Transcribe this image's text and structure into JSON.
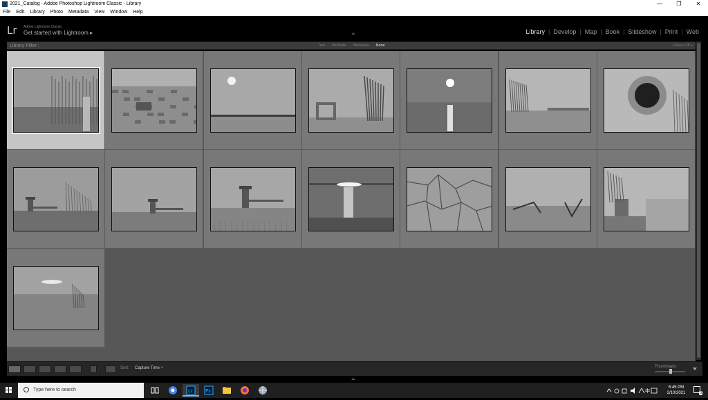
{
  "window": {
    "title": "2021_Catalog - Adobe Photoshop Lightroom Classic - Library",
    "controls": [
      "—",
      "❐",
      "✕"
    ]
  },
  "menu": [
    "File",
    "Edit",
    "Library",
    "Photo",
    "Metadata",
    "View",
    "Window",
    "Help"
  ],
  "identity": {
    "logo": "Lr",
    "product": "Adobe Lightroom Classic",
    "tagline": "Get started with Lightroom",
    "arrow": "▸"
  },
  "modules": [
    "Library",
    "Develop",
    "Map",
    "Book",
    "Slideshow",
    "Print",
    "Web"
  ],
  "active_module": "Library",
  "filter_bar": {
    "label": "Library Filter :",
    "options": [
      "Text",
      "Attribute",
      "Metadata",
      "None"
    ],
    "active_option": "None",
    "filters_off": "Filters Off ÷"
  },
  "grid": {
    "photos": [
      {
        "id": 1,
        "selected": true,
        "scene": "foggy-trees"
      },
      {
        "id": 2,
        "selected": false,
        "scene": "rocky-shore"
      },
      {
        "id": 3,
        "selected": false,
        "scene": "sun-horizon"
      },
      {
        "id": 4,
        "selected": false,
        "scene": "gate-trees"
      },
      {
        "id": 5,
        "selected": false,
        "scene": "sun-water"
      },
      {
        "id": 6,
        "selected": false,
        "scene": "shore-trees"
      },
      {
        "id": 7,
        "selected": false,
        "scene": "pipe-hole"
      },
      {
        "id": 8,
        "selected": false,
        "scene": "pavilion-fog"
      },
      {
        "id": 9,
        "selected": false,
        "scene": "pavilion-far"
      },
      {
        "id": 10,
        "selected": false,
        "scene": "pavilion-near"
      },
      {
        "id": 11,
        "selected": false,
        "scene": "sun-reflection"
      },
      {
        "id": 12,
        "selected": false,
        "scene": "cracked-mud"
      },
      {
        "id": 13,
        "selected": false,
        "scene": "driftwood"
      },
      {
        "id": 14,
        "selected": false,
        "scene": "ruins-shore"
      },
      {
        "id": 15,
        "selected": false,
        "scene": "reeds-sun"
      }
    ]
  },
  "toolbar": {
    "sort_label": "Sort:",
    "sort_value": "Capture Time ÷",
    "thumbnails_label": "Thumbnails"
  },
  "taskbar": {
    "search_placeholder": "Type here to search",
    "time": "6:45 PM",
    "date": "2/10/2021",
    "tray_lang": "中",
    "notification_count": "3"
  }
}
